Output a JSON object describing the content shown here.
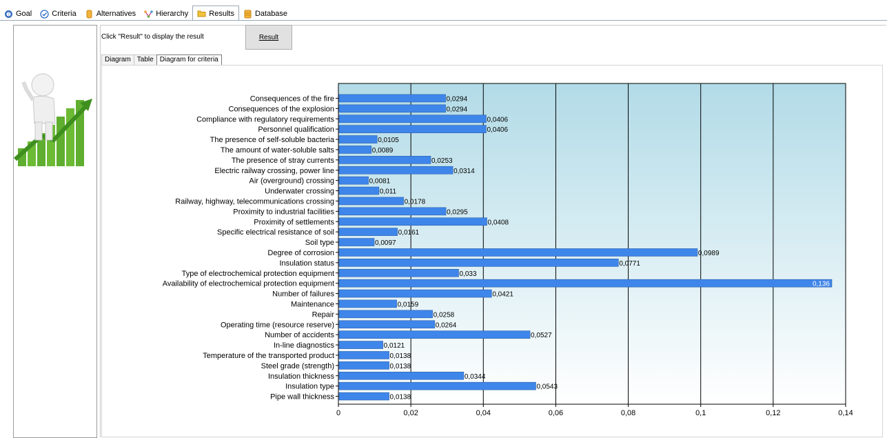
{
  "tabs": [
    {
      "label": "Goal",
      "icon": "goal-icon",
      "active": false
    },
    {
      "label": "Criteria",
      "icon": "check-circle-icon",
      "active": false
    },
    {
      "label": "Alternatives",
      "icon": "cylinder-icon",
      "active": false
    },
    {
      "label": "Hierarchy",
      "icon": "hierarchy-icon",
      "active": false
    },
    {
      "label": "Results",
      "icon": "folder-icon",
      "active": true
    },
    {
      "label": "Database",
      "icon": "database-icon",
      "active": false
    }
  ],
  "hint_text": "Click \"Result\" to display the result",
  "result_button": "Result",
  "subtabs": [
    {
      "label": "Diagram",
      "active": false
    },
    {
      "label": "Table",
      "active": false
    },
    {
      "label": "Diagram for criteria",
      "active": true
    }
  ],
  "colors": {
    "bar": "#3f86ea",
    "bar_edge": "#2a5fa8",
    "plot_top": "#b2dbe7",
    "plot_bottom": "#ffffff"
  },
  "chart_data": {
    "type": "bar",
    "orientation": "horizontal",
    "xlim": [
      0,
      0.14
    ],
    "xticks": [
      "0",
      "0,02",
      "0,04",
      "0,06",
      "0,08",
      "0,1",
      "0,12",
      "0,14"
    ],
    "grid": "vertical",
    "categories": [
      "Consequences of the fire",
      "Consequences of the explosion",
      "Compliance with regulatory requirements",
      "Personnel qualification",
      "The presence of self-soluble bacteria",
      "The amount of water-soluble salts",
      "The presence of stray currents",
      "Electric railway crossing, power line",
      "Air (overground) crossing",
      "Underwater crossing",
      "Railway, highway, telecommunications crossing",
      "Proximity to industrial facilities",
      "Proximity of settlements",
      "Specific electrical resistance of soil",
      "Soil type",
      "Degree of corrosion",
      "Insulation status",
      "Type of electrochemical protection equipment",
      "Availability of electrochemical protection equipment",
      "Number of failures",
      "Maintenance",
      "Repair",
      "Operating time (resource reserve)",
      "Number of accidents",
      "In-line diagnostics",
      "Temperature of the transported product",
      "Steel grade (strength)",
      "Insulation thickness",
      "Insulation type",
      "Pipe wall thickness"
    ],
    "values": [
      0.0294,
      0.0294,
      0.0406,
      0.0406,
      0.0105,
      0.0089,
      0.0253,
      0.0314,
      0.0081,
      0.011,
      0.0178,
      0.0295,
      0.0408,
      0.0161,
      0.0097,
      0.0989,
      0.0771,
      0.033,
      0.136,
      0.0421,
      0.0159,
      0.0258,
      0.0264,
      0.0527,
      0.0121,
      0.0138,
      0.0138,
      0.0344,
      0.0543,
      0.0138
    ],
    "value_labels": [
      "0,0294",
      "0,0294",
      "0,0406",
      "0,0406",
      "0,0105",
      "0,0089",
      "0,0253",
      "0,0314",
      "0,0081",
      "0,011",
      "0,0178",
      "0,0295",
      "0,0408",
      "0,0161",
      "0,0097",
      "0,0989",
      "0,0771",
      "0,033",
      "0,136",
      "0,0421",
      "0,0159",
      "0,0258",
      "0,0264",
      "0,0527",
      "0,0121",
      "0,0138",
      "0,0138",
      "0,0344",
      "0,0543",
      "0,0138"
    ]
  }
}
